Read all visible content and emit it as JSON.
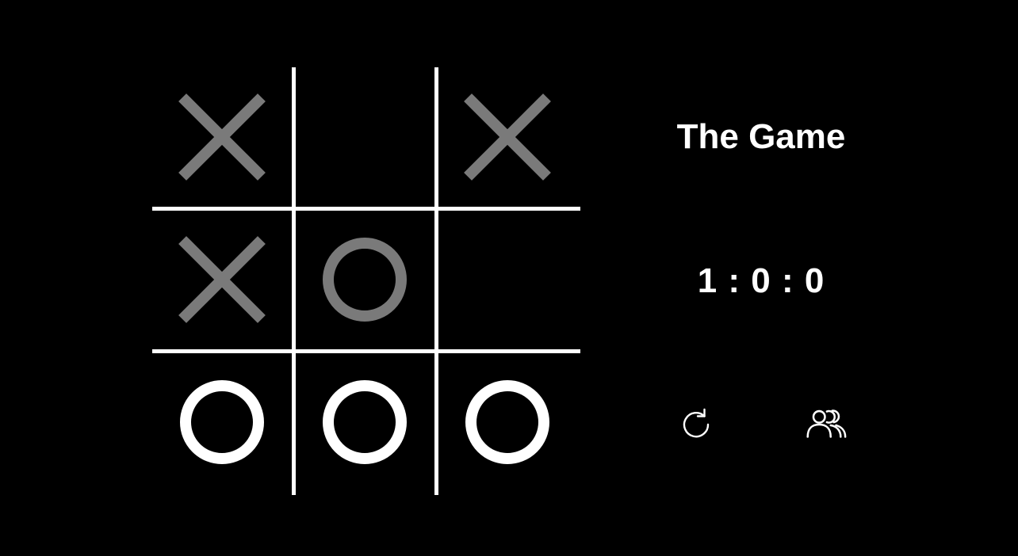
{
  "game": {
    "title": "The Game",
    "score": "1 : 0 : 0"
  },
  "board": {
    "cells": [
      {
        "mark": "X",
        "state": "faded"
      },
      {
        "mark": "",
        "state": "empty"
      },
      {
        "mark": "X",
        "state": "faded"
      },
      {
        "mark": "X",
        "state": "faded"
      },
      {
        "mark": "O",
        "state": "faded"
      },
      {
        "mark": "",
        "state": "empty"
      },
      {
        "mark": "O",
        "state": "winning"
      },
      {
        "mark": "O",
        "state": "winning"
      },
      {
        "mark": "O",
        "state": "winning"
      }
    ]
  },
  "controls": {
    "restart_icon": "refresh-icon",
    "players_icon": "users-icon"
  },
  "colors": {
    "background": "#000000",
    "grid": "#ffffff",
    "winning_mark": "#ffffff",
    "faded_mark": "#7a7a7a",
    "text": "#ffffff"
  }
}
